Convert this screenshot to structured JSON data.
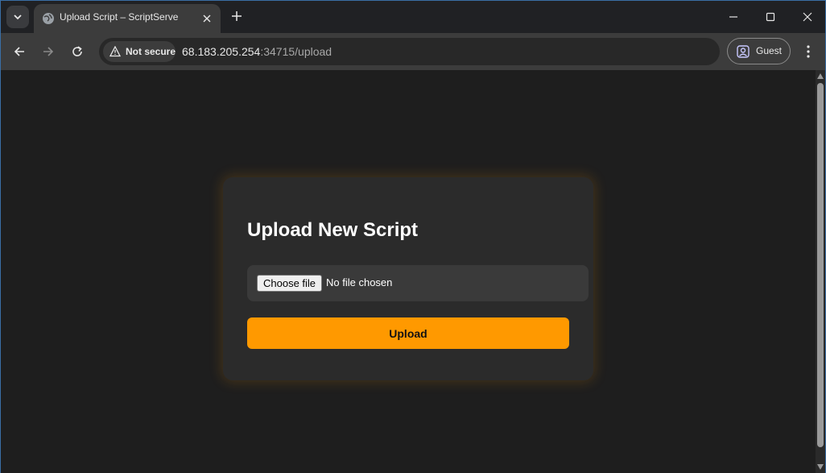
{
  "browser": {
    "tab": {
      "title": "Upload Script – ScriptServe",
      "favicon": "globe-icon"
    },
    "address": {
      "security_label": "Not secure",
      "url_host": "68.183.205.254",
      "url_rest": ":34715/upload"
    },
    "profile": {
      "label": "Guest"
    },
    "colors": {
      "titlebar": "#202124",
      "toolbar": "#3c3c3c"
    }
  },
  "page": {
    "heading": "Upload New Script",
    "file_input": {
      "button_label": "Choose file",
      "status": "No file chosen"
    },
    "upload_button": {
      "label": "Upload",
      "color": "#ff9900"
    }
  }
}
